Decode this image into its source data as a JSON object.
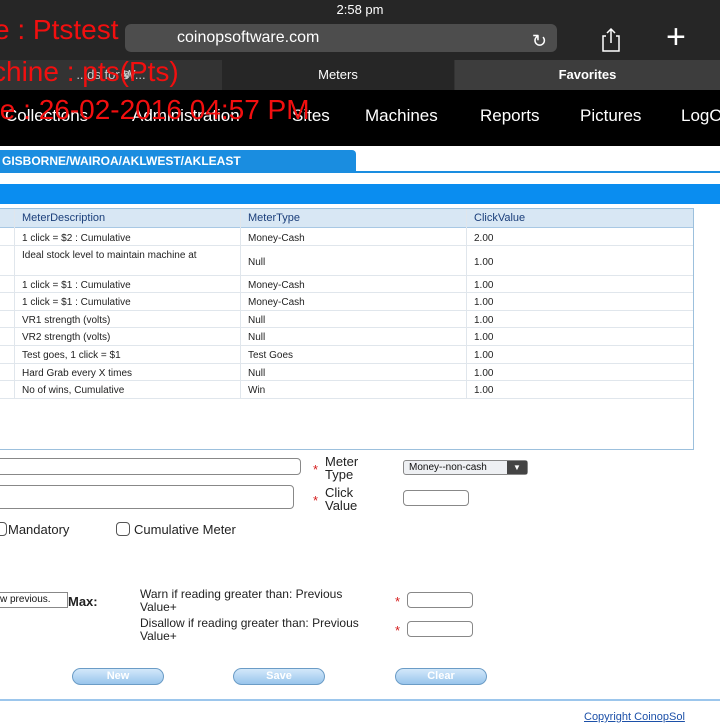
{
  "status_bar": {
    "time": "2:58 pm"
  },
  "browser": {
    "url": "coinopsoftware.com",
    "tabs": [
      {
        "label": "...ds for W..."
      },
      {
        "label": "Meters"
      },
      {
        "label": "Favorites"
      }
    ]
  },
  "watermark": {
    "line1": "e : Ptstest",
    "line2": "chine : pts(Pts)",
    "line3": "te : 26-02-2016 04:57 PM"
  },
  "menu": {
    "items": [
      "Collections",
      "Administration",
      "Sites",
      "Machines",
      "Reports",
      "Pictures",
      "LogO"
    ]
  },
  "site_tab": "GISBORNE/WAIROA/AKLWEST/AKLEAST",
  "grid": {
    "columns": [
      "MeterDescription",
      "MeterType",
      "ClickValue"
    ],
    "rows": [
      {
        "description": "1 click = $2 : Cumulative",
        "type": "Money-Cash",
        "click_value": "2.00"
      },
      {
        "description": "Ideal stock level to maintain machine at",
        "type": "Null",
        "click_value": "1.00"
      },
      {
        "description": "1 click = $1 : Cumulative",
        "type": "Money-Cash",
        "click_value": "1.00"
      },
      {
        "description": "1 click = $1 : Cumulative",
        "type": "Money-Cash",
        "click_value": "1.00"
      },
      {
        "description": "VR1 strength (volts)",
        "type": "Null",
        "click_value": "1.00"
      },
      {
        "description": "VR2 strength (volts)",
        "type": "Null",
        "click_value": "1.00"
      },
      {
        "description": "Test goes, 1 click = $1",
        "type": "Test Goes",
        "click_value": "1.00"
      },
      {
        "description": "Hard Grab every X times",
        "type": "Null",
        "click_value": "1.00"
      },
      {
        "description": "No of wins, Cumulative",
        "type": "Win",
        "click_value": "1.00"
      }
    ]
  },
  "form": {
    "meter_type_label": "Meter Type",
    "meter_type_value": "Money--non-cash",
    "click_value_label": "Click Value",
    "mandatory_label": "Mandatory",
    "cumulative_label": "Cumulative Meter",
    "previous_box_text": "w previous.",
    "max_label": "Max:",
    "warn_label": "Warn if reading greater than: Previous Value+",
    "disallow_label": "Disallow if reading greater than: Previous Value+",
    "required_mark": "*"
  },
  "buttons": {
    "new": "New",
    "save": "Save",
    "clear": "Clear"
  },
  "footer": {
    "copyright": "Copyright  CoinopSol"
  }
}
